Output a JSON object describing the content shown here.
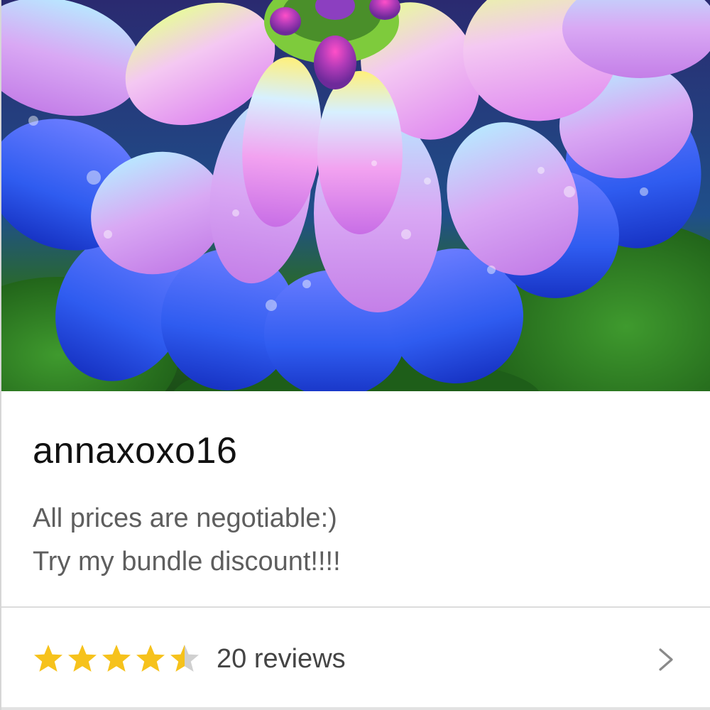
{
  "shop": {
    "name": "annaxoxo16",
    "tagline_line1": "All prices are negotiable:)",
    "tagline_line2": "Try my bundle discount!!!!"
  },
  "reviews": {
    "rating": 4.5,
    "max_rating": 5,
    "count_label": "20 reviews",
    "star_color": "#f6c21c",
    "star_empty_color": "#d0d0d0"
  },
  "icons": {
    "star": "star-icon",
    "chevron": "chevron-right-icon"
  },
  "hero": {
    "subject": "purple-blue dahlia flower with water droplets"
  }
}
